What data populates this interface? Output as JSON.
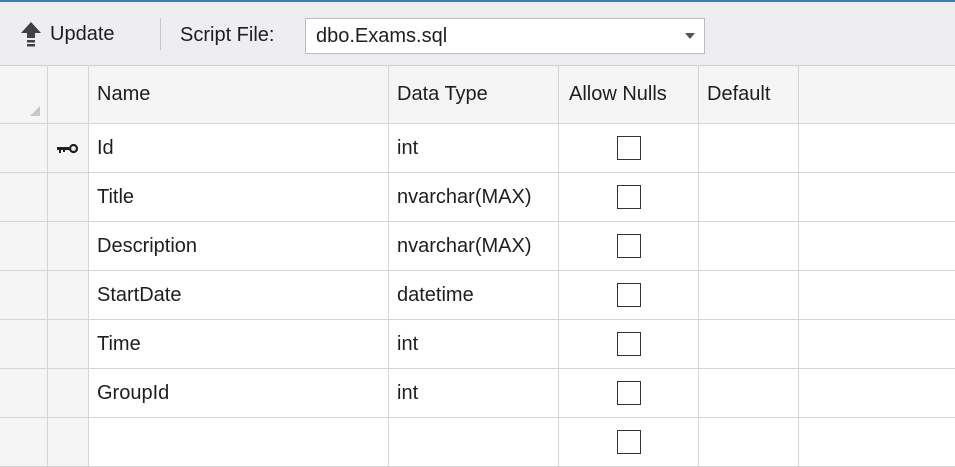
{
  "toolbar": {
    "update_label": "Update",
    "script_file_label": "Script File:",
    "script_file_value": "dbo.Exams.sql"
  },
  "columns": {
    "name": "Name",
    "data_type": "Data Type",
    "allow_nulls": "Allow Nulls",
    "default": "Default"
  },
  "rows": [
    {
      "name": "Id",
      "type": "int",
      "primary_key": true
    },
    {
      "name": "Title",
      "type": "nvarchar(MAX)"
    },
    {
      "name": "Description",
      "type": "nvarchar(MAX)"
    },
    {
      "name": "StartDate",
      "type": "datetime"
    },
    {
      "name": "Time",
      "type": "int"
    },
    {
      "name": "GroupId",
      "type": "int"
    },
    {
      "name": "",
      "type": ""
    }
  ],
  "colors": {
    "accent_line": "#3c7fb1",
    "toolbar_bg": "#eeeef2",
    "grid_line": "#d5d5d5"
  }
}
